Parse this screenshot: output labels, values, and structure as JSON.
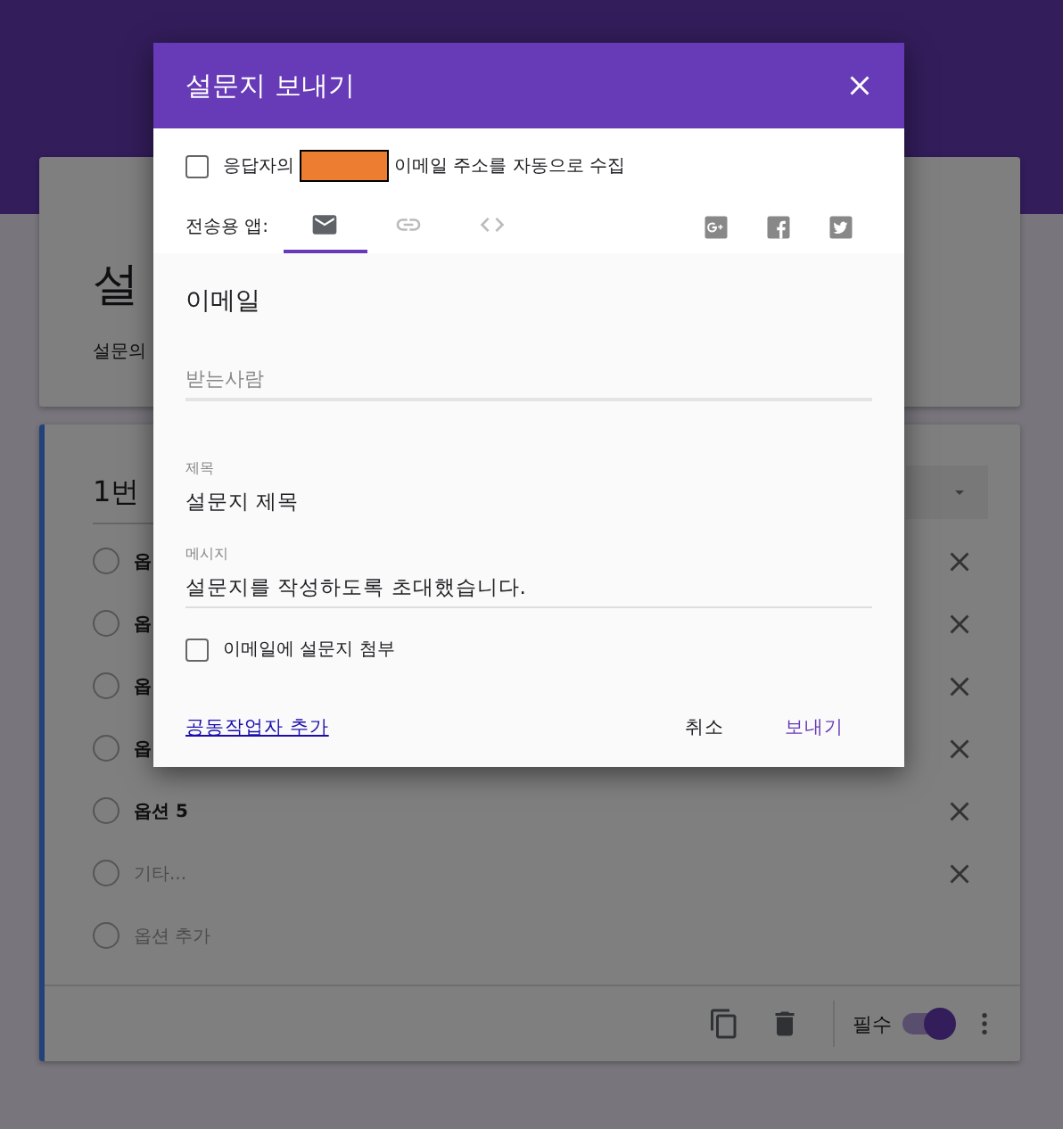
{
  "form": {
    "title": "설",
    "description": "설문의",
    "question": {
      "title": "1번",
      "options": [
        {
          "kind": "option",
          "label": "옵",
          "selected": false
        },
        {
          "kind": "option",
          "label": "옵",
          "selected": false
        },
        {
          "kind": "option",
          "label": "옵",
          "selected": false
        },
        {
          "kind": "option",
          "label": "옵",
          "selected": false
        },
        {
          "kind": "option",
          "label": "옵션 5",
          "selected": false
        },
        {
          "kind": "other",
          "label": "기타...",
          "selected": false
        },
        {
          "kind": "add",
          "label": "옵션 추가",
          "selected": false
        }
      ],
      "required_label": "필수",
      "required": true
    }
  },
  "dialog": {
    "title": "설문지 보내기",
    "collect_email": {
      "label_before": "응답자의",
      "label_after": "이메일 주소를 자동으로 수집",
      "checked": false
    },
    "send_via_label": "전송용 앱:",
    "tabs": [
      {
        "kind": "email",
        "selected": true
      },
      {
        "kind": "link",
        "selected": false
      },
      {
        "kind": "embed",
        "selected": false
      }
    ],
    "section_title": "이메일",
    "to": {
      "placeholder": "받는사람"
    },
    "subject": {
      "label": "제목",
      "value": "설문지 제목"
    },
    "message": {
      "label": "메시지",
      "value": "설문지를 작성하도록 초대했습니다."
    },
    "attach": {
      "label": "이메일에 설문지 첨부",
      "checked": false
    },
    "add_collaborators": "공동작업자 추가",
    "buttons": [
      {
        "kind": "cancel",
        "label": "취소"
      },
      {
        "kind": "send",
        "label": "보내기"
      }
    ]
  }
}
